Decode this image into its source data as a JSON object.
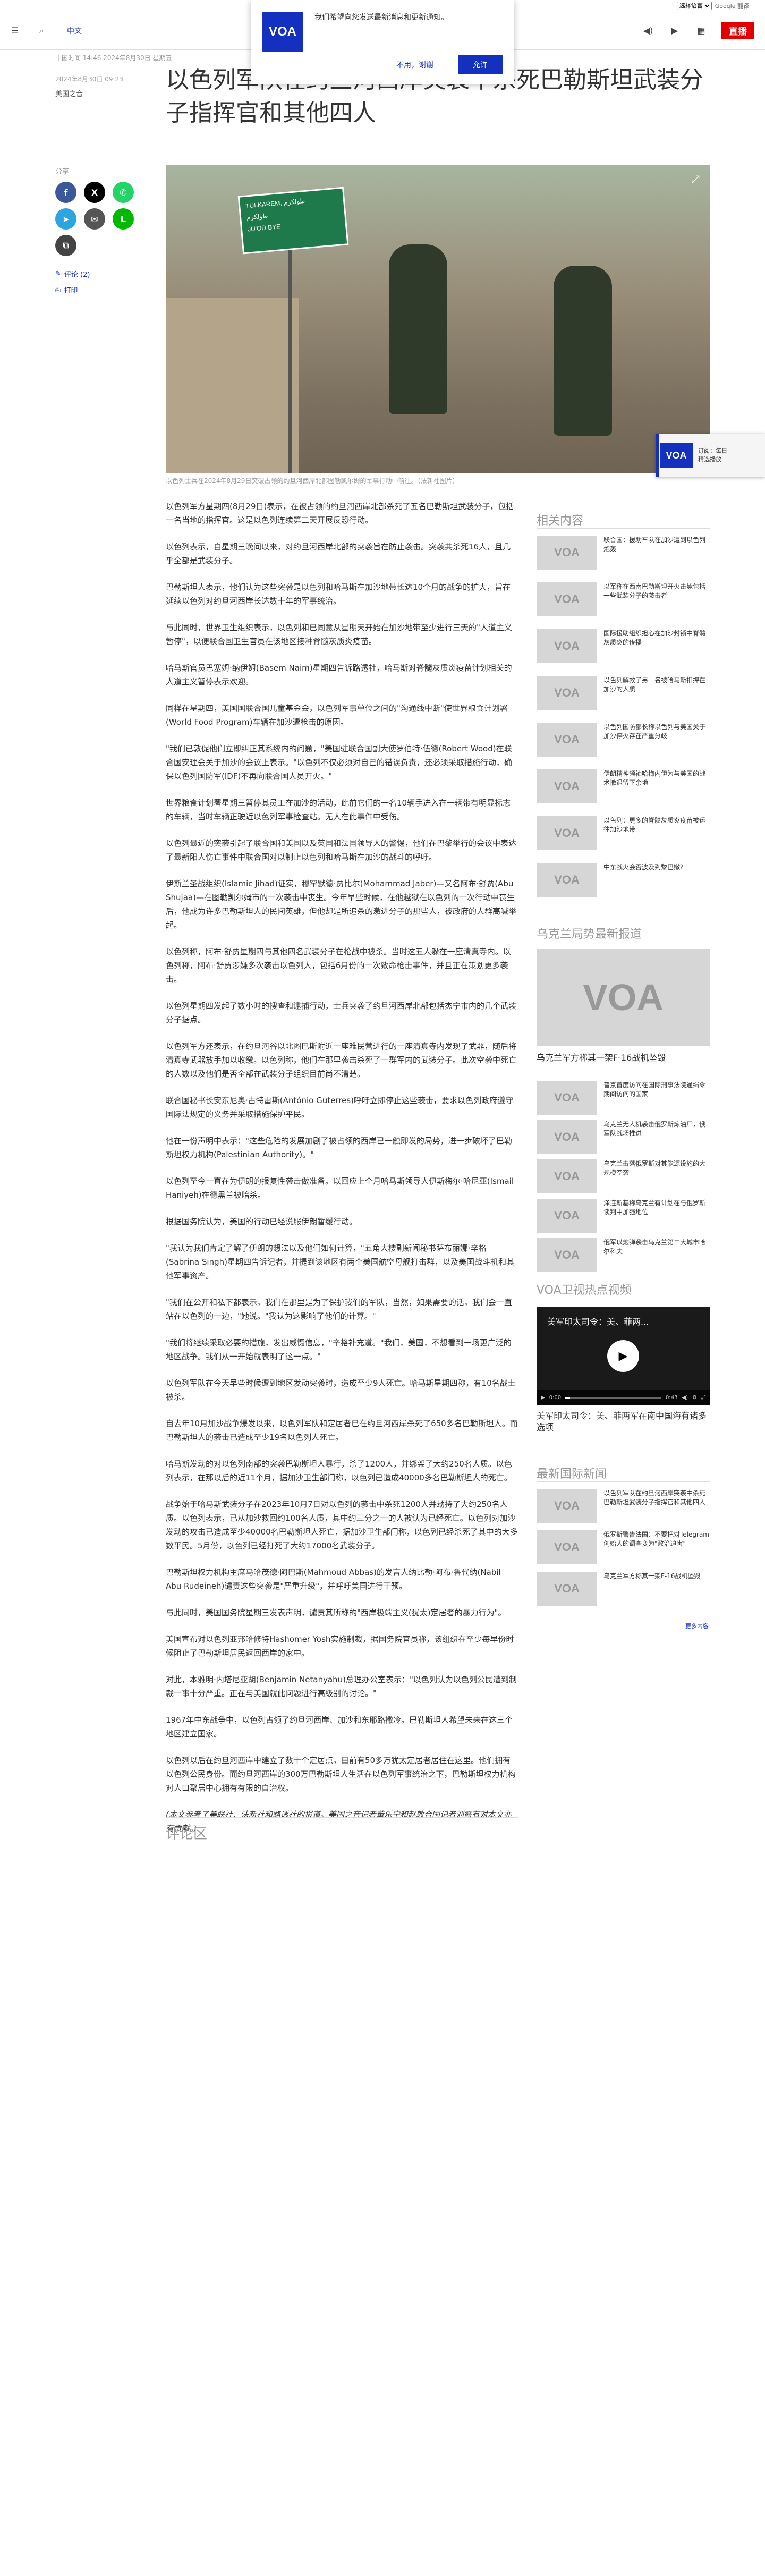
{
  "topbar": {
    "select_label": "选择语言",
    "powered": "Google 翻译"
  },
  "header": {
    "lang": "中文",
    "live": "直播"
  },
  "notification": {
    "logo": "VOA",
    "text": "我们希望向您发送最新消息和更新通知。",
    "no": "不用，谢谢",
    "yes": "允许"
  },
  "article": {
    "meta": "中国时间 14:46 2024年8月30日 星期五",
    "date": "2024年8月30日 09:23",
    "byline": "美国之音",
    "title": "以色列军队在约旦河西岸突袭中杀死巴勒斯坦武装分子指挥官和其他四人",
    "share_label": "分享",
    "comments_link": "评论 (2)",
    "print_link": "打印",
    "hero": {
      "sign_line1": "TULKAREM, طولكرم",
      "sign_line2": "JU'OD BYE",
      "sign_line3": "طولكرم"
    },
    "caption": "以色列士兵在2024年8月29日突破占领的约旦河西岸北部图勒凯尔姆的军事行动中前往。（法新社图片）",
    "paragraphs": [
      "以色列军方星期四(8月29日)表示，在被占领的约旦河西岸北部杀死了五名巴勒斯坦武装分子，包括一名当地的指挥官。这是以色列连续第二天开展反恐行动。",
      "以色列表示，自星期三晚间以来，对约旦河西岸北部的突袭旨在防止袭击。突袭共杀死16人，且几乎全部是武装分子。",
      "巴勒斯坦人表示，他们认为这些突袭是以色列和哈马斯在加沙地带长达10个月的战争的扩大，旨在延续以色列对约旦河西岸长达数十年的军事统治。",
      "与此同时，世界卫生组织表示，以色列和已同意从星期天开始在加沙地带至少进行三天的\"人道主义暂停\"，以便联合国卫生官员在该地区接种脊髓灰质炎疫苗。",
      "哈马斯官员巴塞姆·纳伊姆(Basem Naim)星期四告诉路透社，哈马斯对脊髓灰质炎疫苗计划相关的人道主义暂停表示欢迎。",
      "同样在星期四，美国国联合国儿童基金会，以色列军事单位之间的\"沟通线中断\"使世界粮食计划署(World Food Program)车辆在加沙遭枪击的原因。",
      "\"我们已敦促他们立即纠正其系统内的问题，\"美国驻联合国副大使罗伯特·伍德(Robert Wood)在联合国安理会关于加沙的会议上表示。\"以色列不仅必须对自己的错误负责，还必须采取措施行动，确保以色列国防军(IDF)不再向联合国人员开火。\"",
      "世界粮食计划署星期三暂停其员工在加沙的活动，此前它们的一名10辆手进入在一辆带有明显标志的车辆，当时车辆正驶近以色列军事检查站。无人在此事件中受伤。",
      "以色列最近的突袭引起了联合国和美国以及英国和法国领导人的警惕，他们在巴黎举行的会议中表达了最新阳人伤亡事件中联合国对以制止以色列和哈马斯在加沙的战斗的呼吁。",
      "伊斯兰圣战组织(Islamic Jihad)证实，穆罕默德·贾比尔(Mohammad Jaber)—又名阿布·舒贾(Abu Shujaa)—在图勒凯尔姆市的一次袭击中丧生。今年早些时候，在他越狱在以色列的一次行动中丧生后，他成为许多巴勒斯坦人的民间英雄，但他却是所追杀的激进分子的那些人，被政府的人群高喊举起。",
      "以色列称，阿布·舒贾星期四与其他四名武装分子在枪战中被杀。当时这五人躲在一座清真寺内。以色列称，阿布·舒贾涉嫌多次袭击以色列人，包括6月份的一次致命枪击事件，并且正在策划更多袭击。",
      "以色列星期四发起了数小时的搜查和逮捕行动，士兵突袭了约旦河西岸北部包括杰宁市内的几个武装分子据点。",
      "以色列军方还表示，在约旦河谷以北图巴斯附近一座难民营进行的一座清真寺内发现了武器，随后将清真寺武器放手加以收缴。以色列称，他们在那里袭击杀死了一群军内的武装分子。此次空袭中死亡的人数以及他们是否全部在武装分子组织目前尚不清楚。",
      "联合国秘书长安东尼奥·古特雷斯(António Guterres)呼吁立即停止这些袭击，要求以色列政府遵守国际法规定的义务并采取措施保护平民。",
      "他在一份声明中表示：\"这些危险的发展加剧了被占领的西岸已一触即发的局势，进一步破坏了巴勒斯坦权力机构(Palestinian Authority)。\"",
      "以色列至今一直在为伊朗的报复性袭击做准备。以回应上个月哈马斯领导人伊斯梅尔·哈尼亚(Ismail Haniyeh)在德黑兰被暗杀。",
      "根据国务院认为，美国的行动已经说服伊朗暂缓行动。",
      "\"我认为我们肯定了解了伊朗的想法以及他们如何计算，\"五角大楼副新闻秘书萨布丽娜·辛格(Sabrina Singh)星期四告诉记者，并提到该地区有两个美国航空母舰打击群，以及美国战斗机和其他军事资产。",
      "\"我们在公开和私下都表示，我们在那里是为了保护我们的军队，当然，如果需要的话，我们会一直站在以色列的一边，\"她说。\"我认为这影响了他们的计算。\"",
      "\"我们将继续采取必要的措施，发出威慑信息，\"辛格补充道。\"我们，美国，不想看到一场更广泛的地区战争。我们从一开始就表明了这一点。\"",
      "以色列军队在今天早些时候遭到地区发动突袭时，造成至少9人死亡。哈马斯星期四称，有10名战士被杀。",
      "自去年10月加沙战争爆发以来，以色列军队和定居者已在约旦河西岸杀死了650多名巴勒斯坦人。而巴勒斯坦人的袭击已造成至少19名以色列人死亡。",
      "哈马斯发动的对以色列南部的突袭巴勒斯坦人暴行，杀了1200人，并绑架了大约250名人质。以色列表示，在那以后的近11个月，据加沙卫生部门称，以色列已造成40000多名巴勒斯坦人的死亡。",
      "战争始于哈马斯武装分子在2023年10月7日对以色列的袭击中杀死1200人并劫持了大约250名人质。以色列表示，已从加沙救回约100名人质，其中约三分之一的人被认为已经死亡。以色列对加沙发动的攻击已造成至少40000名巴勒斯坦人死亡，据加沙卫生部门称，以色列已经杀死了其中的大多数平民。5月份，以色列已经打死了大约17000名武装分子。",
      "巴勒斯坦权力机构主席马哈茂德·阿巴斯(Mahmoud Abbas)的发言人纳比勒·阿布·鲁代纳(Nabil Abu Rudeineh)谴责这些突袭是\"严重升级\"，并呼吁美国进行干预。",
      "与此同时，美国国务院星期三发表声明，谴责其所称的\"西岸极端主义(犹太)定居者的暴力行为\"。",
      "美国宣布对以色列亚邦哈修特Hashomer Yosh实施制裁，据国务院官员称，该组织在至少每早份时候阻止了巴勒斯坦居民返回西岸的家中。",
      "对此，本雅明·内塔尼亚胡(Benjamin Netanyahu)总理办公室表示：\"以色列认为以色列公民遭到制裁一事十分严重。正在与美国就此问题进行高级别的讨论。\"",
      "1967年中东战争中，以色列占领了约旦河西岸、加沙和东耶路撒冷。巴勒斯坦人希望未来在这三个地区建立国家。",
      "以色列以后在约旦河西岸中建立了数十个定居点，目前有50多万犹太定居者居住在这里。他们拥有以色列公民身份。而约旦河西岸的300万巴勒斯坦人生活在以色列军事统治之下，巴勒斯坦权力机构对人口聚居中心拥有有限的自治权。"
    ],
    "note": "(本文参考了美联社、法新社和路透社的报道。美国之音记者董乐宁和赵敦合国记者刘霞有对本文亦有贡献。)",
    "comments_header": "评论区"
  },
  "sidebar": {
    "related_title": "相关内容",
    "related": [
      "联合国：援助车队在加沙遭到以色列炮轰",
      "以军称在西南巴勒斯坦开火击毙包括一些武装分子的袭击者",
      "国际援助组织担心在加沙封锁中脊髓灰质炎的传播",
      "以色列解救了另一名被哈马斯扣押在加沙的人质",
      "以色列国防部长称以色列与美国关于加沙停火存在严重分歧",
      "伊朗精神领袖哈梅内伊为与美国的战术撤退留下余地",
      "以色列：更多的脊髓灰质炎疫苗被运往加沙地带",
      "中东战火会否波及到黎巴嫩？"
    ],
    "ukraine_title": "乌克兰局势最新报道",
    "ukraine_main": "乌克兰军方称其一架F-16战机坠毁",
    "ukraine": [
      "普京首度访问在国际刑事法院通缉令期间访问的国家",
      "乌克兰无人机袭击俄罗斯炼油厂，俄军队战场推进",
      "乌克兰击落俄罗斯对其能源设施的大规模空袭",
      "泽连斯基称乌克兰有计划在与俄罗斯谈判中加强地位",
      "俄军以炮弹袭击乌克兰第二大城市哈尔科夫"
    ],
    "video_title": "VOA卫视热点视频",
    "video": {
      "overlay": "美军印太司令：美、菲两...",
      "time_start": "0:00",
      "time_end": "0:43",
      "caption": "美军印太司令：美、菲两军在南中国海有诸多选项",
      "progress": 0.05
    },
    "intl_title": "最新国际新闻",
    "intl": [
      "以色列军队在约旦河西岸突袭中杀死巴勒斯坦武装分子指挥官和其他四人",
      "俄罗斯警告法国：不要把对Telegram创始人的调查变为\"政治迫害\"",
      "乌克兰军方称其一架F-16战机坠毁"
    ],
    "more": "更多内容",
    "popup": {
      "logo": "VOA",
      "line1": "订阅：每日",
      "line2": "精选播放"
    }
  },
  "colors": {
    "brand": "#1330bf",
    "live": "#e00000",
    "facebook": "#3b5998",
    "x": "#000000",
    "whatsapp": "#25d366",
    "telegram": "#2ca5e0",
    "email": "#555555",
    "line": "#00b900",
    "copy": "#444444"
  }
}
